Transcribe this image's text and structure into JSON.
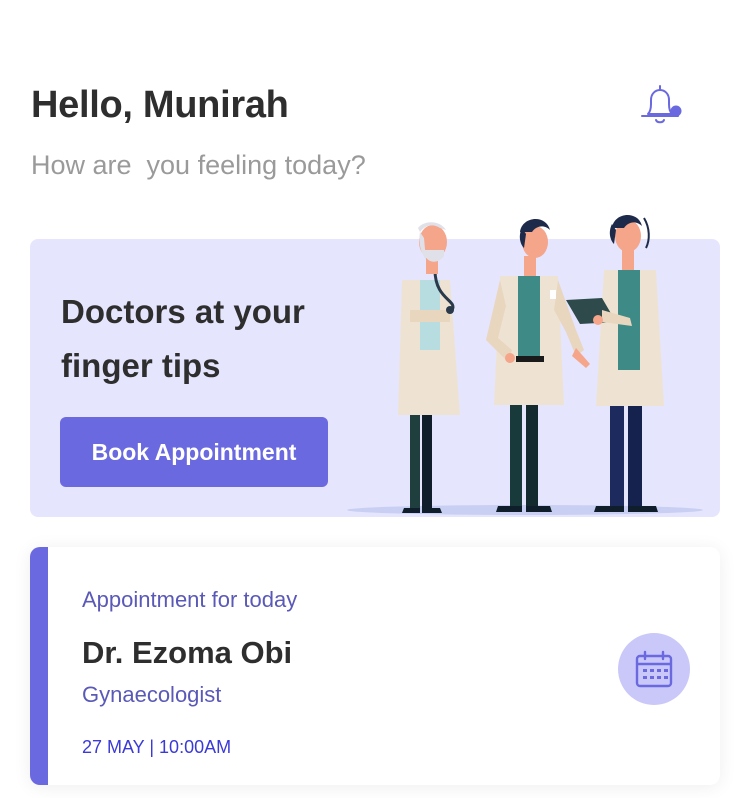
{
  "header": {
    "greeting": "Hello, Munirah",
    "subtitle": "How are  you feeling today?",
    "bell_icon": "bell-icon",
    "notification_dot": "#6a69e0"
  },
  "hero": {
    "title": "Doctors at your finger tips",
    "button_label": "Book Appointment",
    "background": "#e5e5fe",
    "illustration": "doctors-illustration"
  },
  "appointment": {
    "label": "Appointment for today",
    "doctor": "Dr. Ezoma Obi",
    "specialty": "Gynaecologist",
    "datetime": "27 MAY | 10:00AM",
    "icon": "calendar-icon",
    "accent": "#6a69e0"
  }
}
